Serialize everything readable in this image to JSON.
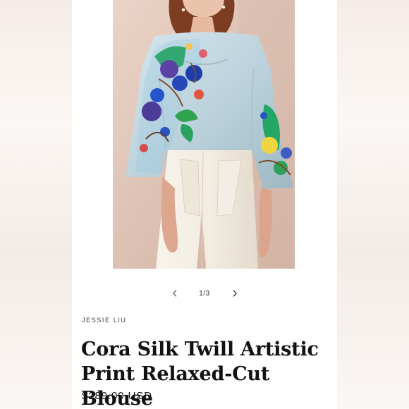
{
  "product": {
    "vendor": "JESSIE LIU",
    "title": "Cora Silk Twill Artistic Print Relaxed-Cut Blouse",
    "price": "$289.00 USD"
  },
  "gallery": {
    "counter": "1/3",
    "prev_icon": "chevron-left-icon",
    "next_icon": "chevron-right-icon"
  },
  "colors": {
    "page_background": "#ffffff",
    "side_background": "#f6ece7",
    "text": "#121212",
    "blouse": "#b8cfd9",
    "trousers": "#f4efe6",
    "photo_background": "#d9c1b3"
  }
}
